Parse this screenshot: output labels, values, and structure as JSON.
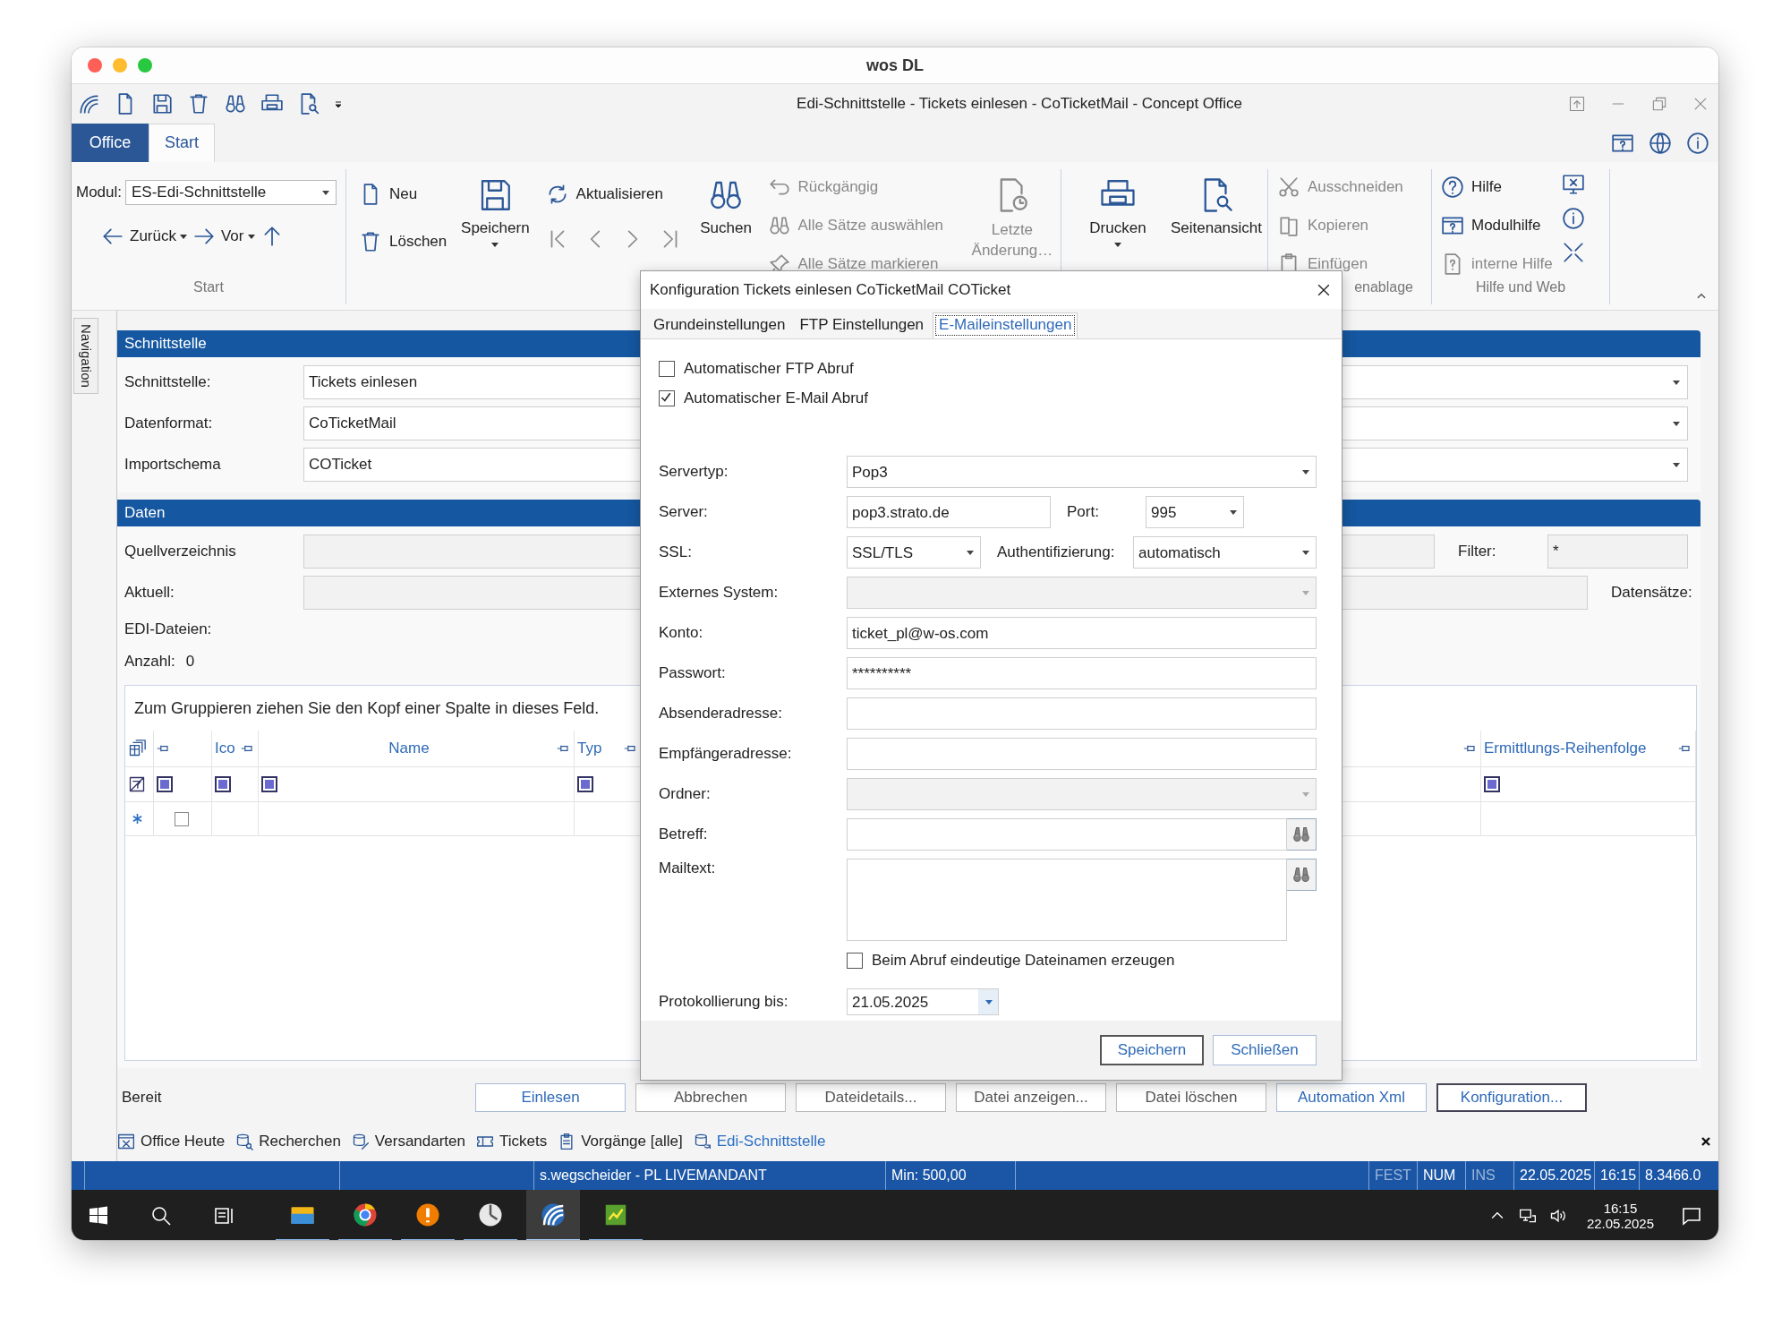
{
  "window": {
    "title": "wos DL"
  },
  "app_title": "Edi-Schnittstelle - Tickets einlesen - CoTicketMail - Concept Office",
  "ribbon_tabs": [
    {
      "label": "Office",
      "selected": false
    },
    {
      "label": "Start",
      "selected": true
    }
  ],
  "ribbon": {
    "module": {
      "label": "Modul:",
      "value": "ES-Edi-Schnittstelle"
    },
    "history": [
      {
        "label": "Zurück"
      },
      {
        "label": "Vor"
      }
    ],
    "start_group_label": "Start",
    "file_actions": [
      {
        "label": "Neu"
      },
      {
        "label": "Löschen"
      }
    ],
    "save": {
      "label": "Speichern"
    },
    "refresh": {
      "label": "Aktualisieren"
    },
    "search": {
      "label": "Suchen"
    },
    "record_actions": [
      {
        "label": "Rückgängig",
        "disabled": true
      },
      {
        "label": "Alle Sätze auswählen",
        "disabled": true
      },
      {
        "label": "Alle Sätze markieren",
        "disabled": true
      }
    ],
    "last_change": {
      "label": "Letzte Änderung…",
      "disabled": true
    },
    "print": {
      "label": "Drucken"
    },
    "preview": {
      "label": "Seitenansicht"
    },
    "clipboard": [
      {
        "label": "Ausschneiden",
        "disabled": true
      },
      {
        "label": "Kopieren",
        "disabled": true
      },
      {
        "label": "Einfügen",
        "disabled": true
      }
    ],
    "clipboard_group_label": "enablage",
    "help": [
      {
        "label": "Hilfe",
        "disabled": false
      },
      {
        "label": "Modulhilfe",
        "disabled": false
      },
      {
        "label": "interne Hilfe",
        "disabled": true
      }
    ],
    "help_group_label": "Hilfe und Web"
  },
  "navigation_tab": "Navigation",
  "interface_section": {
    "title": "Schnittstelle",
    "rows": [
      {
        "label": "Schnittstelle:",
        "value": "Tickets einlesen"
      },
      {
        "label": "Datenformat:",
        "value": "CoTicketMail"
      },
      {
        "label": "Importschema",
        "value": "COTicket"
      }
    ]
  },
  "data_section": {
    "title": "Daten",
    "source_label": "Quellverzeichnis",
    "current_label": "Aktuell:",
    "filter_label": "Filter:",
    "filter_value": "*",
    "records_label": "Datensätze:",
    "files_label": "EDI-Dateien:",
    "count_label": "Anzahl:",
    "count": "0"
  },
  "grid": {
    "group_hint": "Zum Gruppieren ziehen Sie den Kopf einer Spalte in dieses Feld.",
    "columns": [
      "Ico",
      "Name",
      "Typ",
      "Ermittlungs-Reihenfolge"
    ],
    "new_row_checked": false
  },
  "status_text": "Bereit",
  "actions": [
    {
      "label": "Einlesen",
      "disabled": false,
      "focused": false
    },
    {
      "label": "Abbrechen",
      "disabled": true,
      "focused": false
    },
    {
      "label": "Dateidetails...",
      "disabled": true,
      "focused": false
    },
    {
      "label": "Datei anzeigen...",
      "disabled": true,
      "focused": false
    },
    {
      "label": "Datei löschen",
      "disabled": true,
      "focused": false
    },
    {
      "label": "Automation Xml",
      "disabled": false,
      "focused": false
    },
    {
      "label": "Konfiguration...",
      "disabled": false,
      "focused": true
    }
  ],
  "module_tabs": [
    {
      "label": "Office Heute",
      "selected": false
    },
    {
      "label": "Recherchen",
      "selected": false
    },
    {
      "label": "Versandarten",
      "selected": false
    },
    {
      "label": "Tickets",
      "selected": false
    },
    {
      "label": "Vorgänge [alle]",
      "selected": false
    },
    {
      "label": "Edi-Schnittstelle",
      "selected": true
    }
  ],
  "status_bar": {
    "user": "s.wegscheider - PL LIVEMANDANT",
    "minimum": "Min: 500,00",
    "indicators": [
      {
        "label": "FEST",
        "on": false
      },
      {
        "label": "NUM",
        "on": true
      },
      {
        "label": "INS",
        "on": false
      }
    ],
    "date": "22.05.2025",
    "time": "16:15",
    "version": "8.3466.0"
  },
  "taskbar": {
    "apps": [
      {
        "selected": false
      },
      {
        "selected": false
      },
      {
        "selected": false
      },
      {
        "selected": false
      },
      {
        "selected": true
      },
      {
        "selected": false
      }
    ],
    "time": "16:15",
    "date": "22.05.2025"
  },
  "dialog": {
    "title": "Konfiguration Tickets einlesen CoTicketMail COTicket",
    "tabs": [
      {
        "label": "Grundeinstellungen",
        "selected": false
      },
      {
        "label": "FTP Einstellungen",
        "selected": false
      },
      {
        "label": "E-Maileinstellungen",
        "selected": true
      }
    ],
    "options": [
      {
        "label": "Automatischer FTP Abruf",
        "checked": false
      },
      {
        "label": "Automatischer E-Mail Abruf",
        "checked": true
      }
    ],
    "fields": [
      {
        "kind": "select",
        "label": "Servertyp:",
        "value": "Pop3",
        "disabled": false
      },
      {
        "kind": "server",
        "label": "Server:",
        "value": "pop3.strato.de",
        "port_label": "Port:",
        "port": "995"
      },
      {
        "kind": "ssl",
        "label": "SSL:",
        "value": "SSL/TLS",
        "auth_label": "Authentifizierung:",
        "auth": "automatisch"
      },
      {
        "kind": "select",
        "label": "Externes System:",
        "disabled": true
      },
      {
        "kind": "text",
        "label": "Konto:",
        "value": "ticket_pl@w-os.com"
      },
      {
        "kind": "text",
        "label": "Passwort:",
        "value": "**********"
      },
      {
        "kind": "text",
        "label": "Absenderadresse:"
      },
      {
        "kind": "text",
        "label": "Empfängeradresse:"
      },
      {
        "kind": "select",
        "label": "Ordner:",
        "disabled": true
      },
      {
        "kind": "search",
        "label": "Betreff:"
      },
      {
        "kind": "memo",
        "label": "Mailtext:"
      }
    ],
    "unique_names": {
      "label": "Beim Abruf eindeutige Dateinamen erzeugen",
      "checked": false
    },
    "log_until": {
      "label": "Protokollierung bis:",
      "value": "21.05.2025"
    },
    "buttons": [
      {
        "label": "Speichern",
        "default": true
      },
      {
        "label": "Schließen",
        "default": false
      }
    ]
  }
}
